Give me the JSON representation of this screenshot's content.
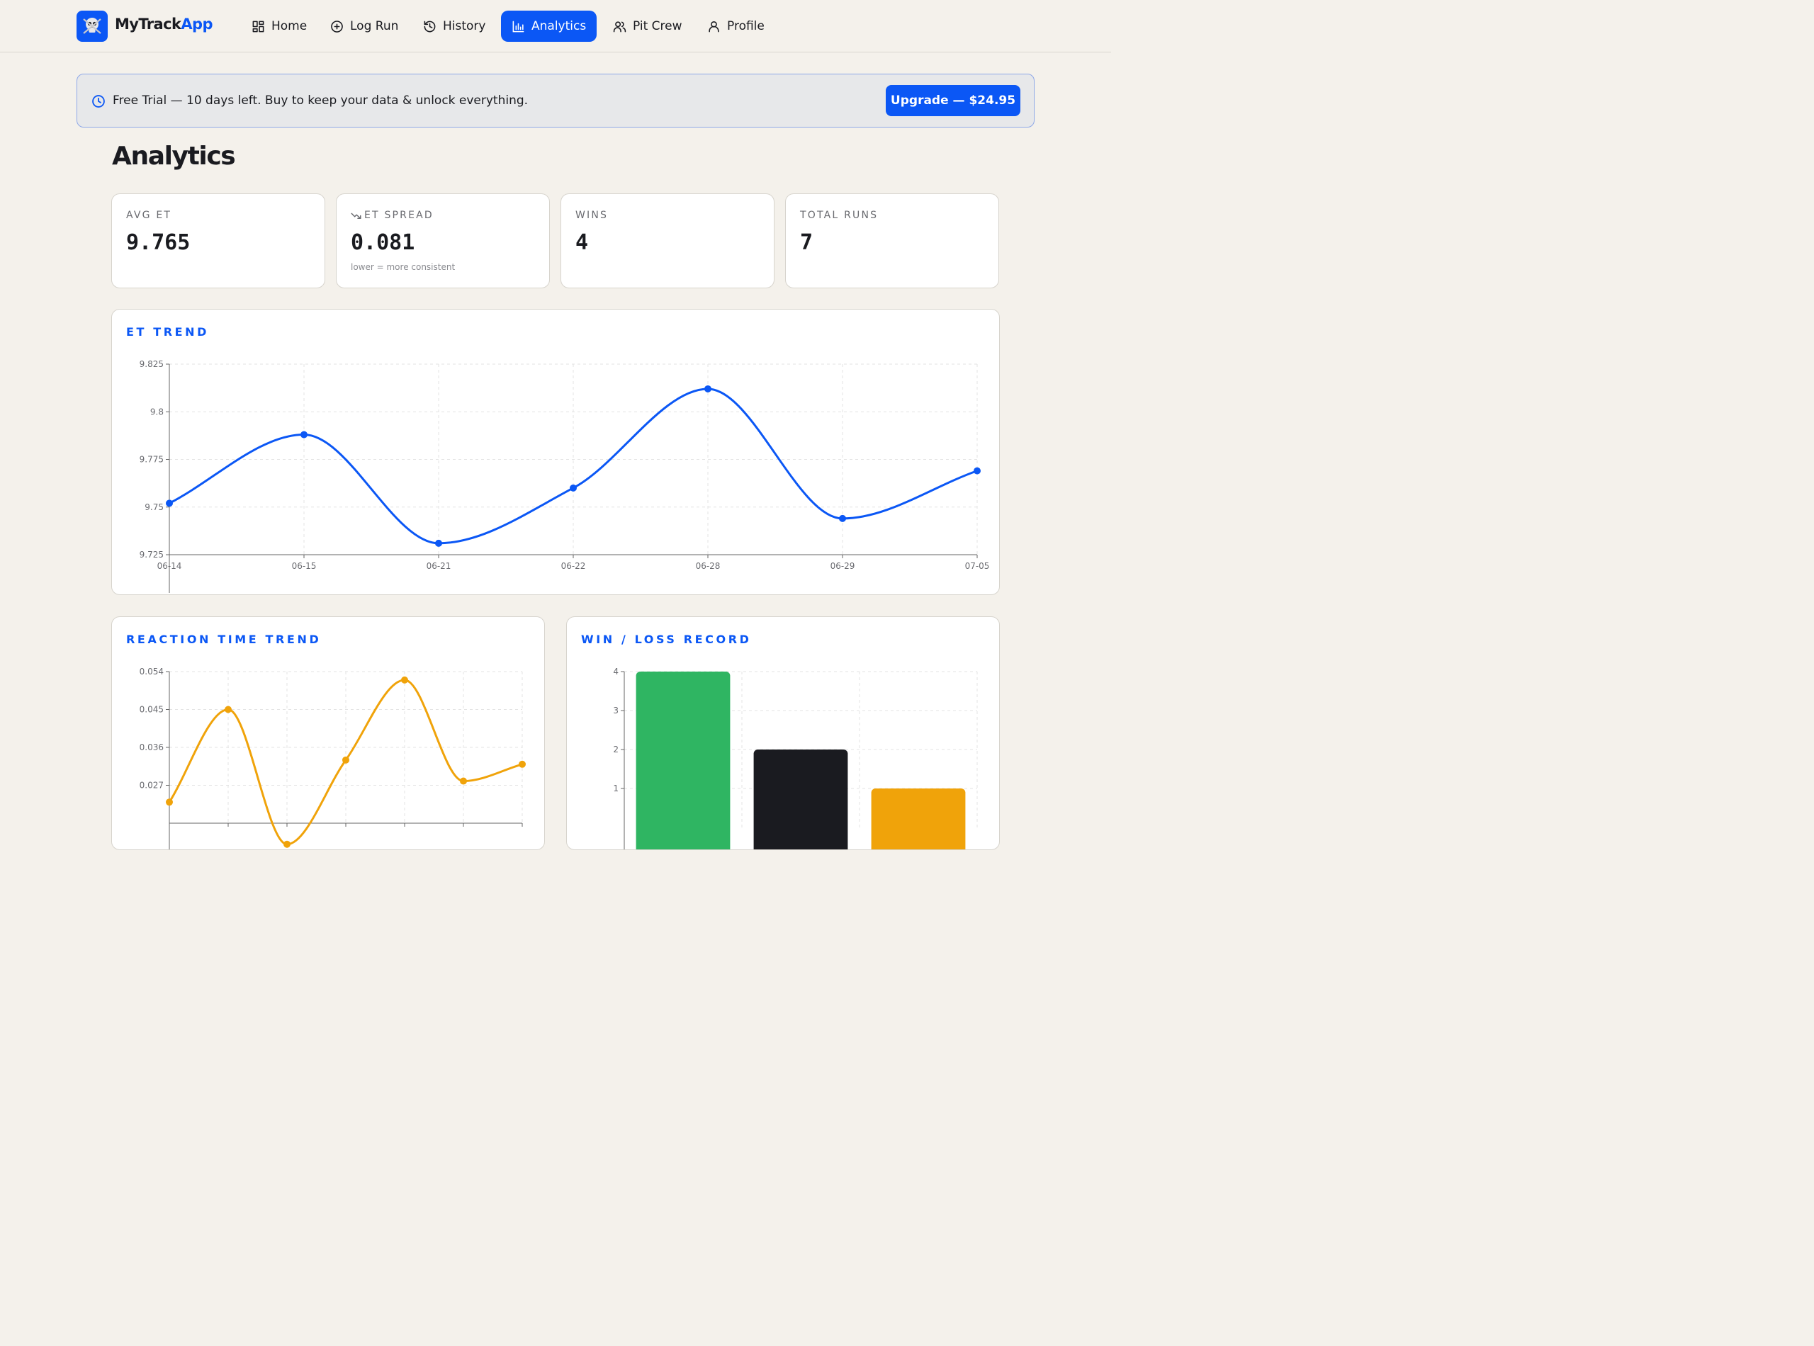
{
  "brand": {
    "name_part1": "MyTrack",
    "name_part2": "App"
  },
  "nav": {
    "items": [
      {
        "label": "Home",
        "icon": "grid-icon"
      },
      {
        "label": "Log Run",
        "icon": "plus-circle-icon"
      },
      {
        "label": "History",
        "icon": "history-icon"
      },
      {
        "label": "Analytics",
        "icon": "bar-chart-icon",
        "active": true
      },
      {
        "label": "Pit Crew",
        "icon": "users-icon"
      },
      {
        "label": "Profile",
        "icon": "user-icon"
      }
    ]
  },
  "banner": {
    "message": "Free Trial — 10 days left. Buy to keep your data & unlock everything.",
    "button_label": "Upgrade — $24.95"
  },
  "page": {
    "title": "Analytics"
  },
  "stats": [
    {
      "label": "AVG ET",
      "value": "9.765",
      "note": ""
    },
    {
      "label": "ET SPREAD",
      "value": "0.081",
      "note": "lower = more consistent",
      "icon": "trending-down-icon"
    },
    {
      "label": "WINS",
      "value": "4",
      "note": ""
    },
    {
      "label": "TOTAL RUNS",
      "value": "7",
      "note": ""
    }
  ],
  "colors": {
    "accent": "#0b57f5",
    "reaction": "#f0a30a",
    "win": "#2fb562",
    "loss": "#1a1b20",
    "other": "#f0a30a"
  },
  "chart_data": [
    {
      "type": "line",
      "title": "ET TREND",
      "x": [
        "06-14",
        "06-15",
        "06-21",
        "06-22",
        "06-28",
        "06-29",
        "07-05"
      ],
      "values": [
        9.752,
        9.788,
        9.731,
        9.76,
        9.812,
        9.744,
        9.769
      ],
      "ylim": [
        9.725,
        9.825
      ],
      "yticks": [
        "9.825",
        "9.8",
        "9.775",
        "9.75",
        "9.725"
      ],
      "grid": true
    },
    {
      "type": "line",
      "title": "REACTION TIME TREND",
      "x": [
        "",
        "",
        "",
        "",
        "",
        "",
        ""
      ],
      "values": [
        0.023,
        0.045,
        0.013,
        0.033,
        0.052,
        0.028,
        0.032
      ],
      "ylim": [
        0.018,
        0.054
      ],
      "yticks": [
        "0.054",
        "0.045",
        "0.036",
        "0.027"
      ],
      "grid": true
    },
    {
      "type": "bar",
      "title": "WIN / LOSS RECORD",
      "categories": [
        "",
        "",
        ""
      ],
      "values": [
        4,
        2,
        1
      ],
      "ylim": [
        0,
        4
      ],
      "yticks": [
        "4",
        "3",
        "2",
        "1"
      ],
      "grid": true
    }
  ]
}
